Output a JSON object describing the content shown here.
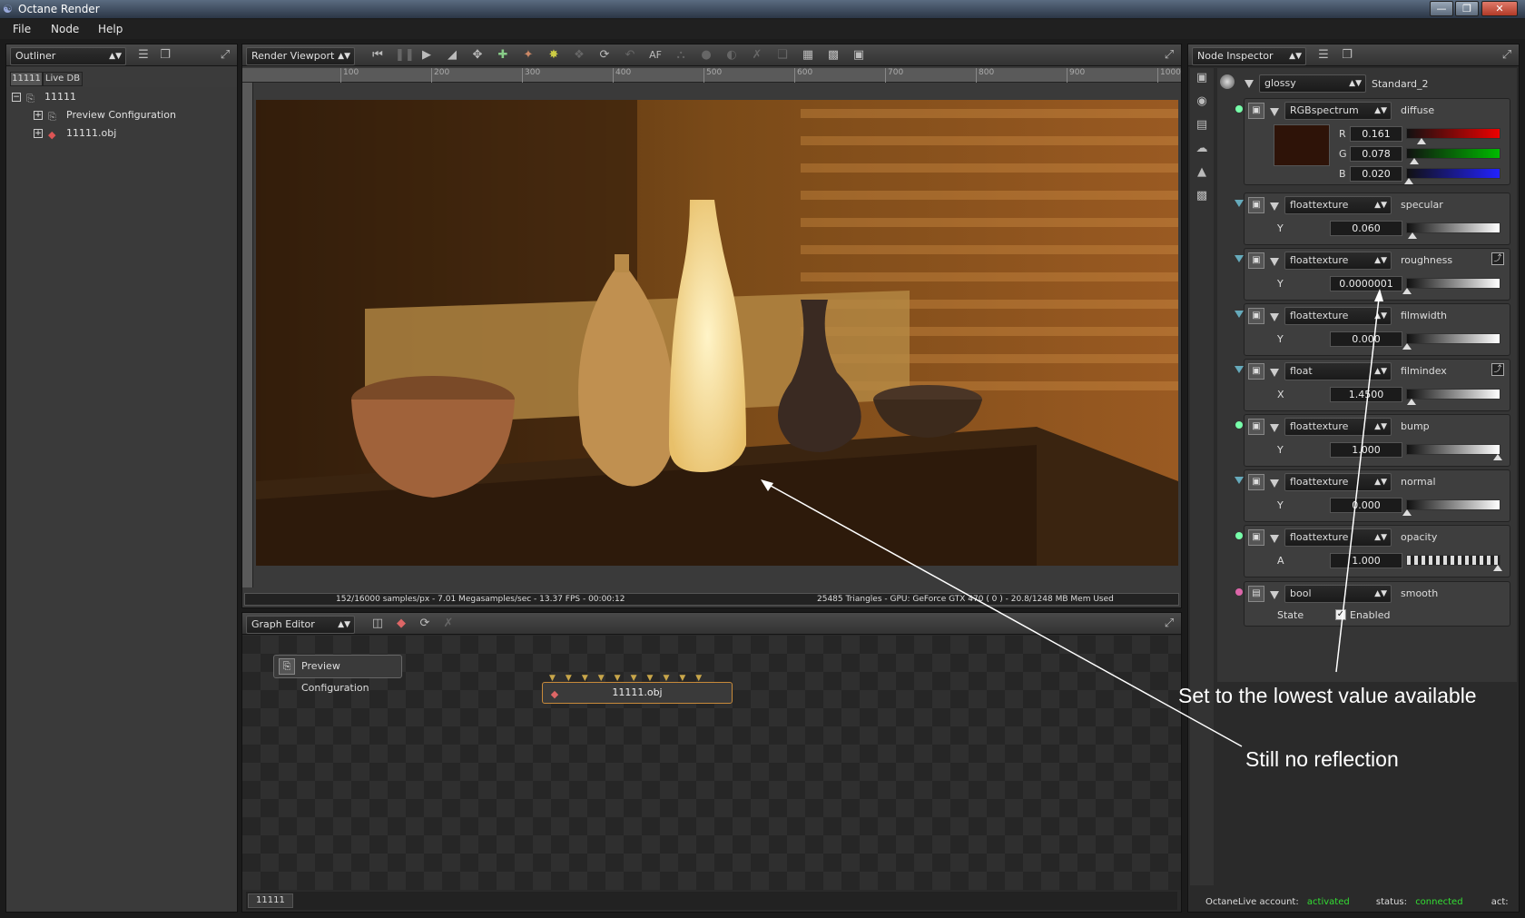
{
  "window": {
    "title": "Octane Render"
  },
  "menu": [
    "File",
    "Node",
    "Help"
  ],
  "outliner": {
    "dropdown": "Outliner",
    "tabs": [
      "11111",
      "Live DB"
    ],
    "tree": [
      {
        "label": "11111",
        "level": 0
      },
      {
        "label": "Preview Configuration",
        "level": 1
      },
      {
        "label": "11111.obj",
        "level": 1
      }
    ]
  },
  "viewport": {
    "dropdown": "Render Viewport",
    "af_label": "AF",
    "ruler_labels": [
      "100",
      "200",
      "300",
      "400",
      "500",
      "600",
      "700",
      "800",
      "900",
      "1000"
    ],
    "status_left": "152/16000 samples/px - 7.01 Megasamples/sec - 13.37 FPS - 00:00:12",
    "status_right": "25485 Triangles - GPU: GeForce GTX 470 ( 0 ) - 20.8/1248 MB Mem Used"
  },
  "graph_editor": {
    "dropdown": "Graph Editor",
    "nodes": [
      "Preview Configuration",
      "11111.obj"
    ],
    "bottom_tab": "11111"
  },
  "inspector": {
    "dropdown": "Node Inspector",
    "material_type": "glossy",
    "material_name": "Standard_2",
    "diffuse": {
      "type": "RGBspectrum",
      "name": "diffuse",
      "r_label": "R",
      "g_label": "G",
      "b_label": "B",
      "r": "0.161",
      "g": "0.078",
      "b": "0.020",
      "swatch": "#2e1308"
    },
    "params": [
      {
        "type": "floattexture",
        "name": "specular",
        "axis": "Y",
        "value": "0.060",
        "fraction": 0.06
      },
      {
        "type": "floattexture",
        "name": "roughness",
        "axis": "Y",
        "value": "0.0000001",
        "fraction": 0.0
      },
      {
        "type": "floattexture",
        "name": "filmwidth",
        "axis": "Y",
        "value": "0.000",
        "fraction": 0.0
      },
      {
        "type": "float",
        "name": "filmindex",
        "axis": "X",
        "value": "1.4500",
        "fraction": 0.05
      },
      {
        "type": "floattexture",
        "name": "bump",
        "axis": "Y",
        "value": "1.000",
        "fraction": 1.0
      },
      {
        "type": "floattexture",
        "name": "normal",
        "axis": "Y",
        "value": "0.000",
        "fraction": 0.0
      },
      {
        "type": "floattexture",
        "name": "opacity",
        "axis": "A",
        "value": "1.000",
        "fraction": 1.0
      }
    ],
    "smooth": {
      "type": "bool",
      "name": "smooth",
      "label": "State",
      "value_label": "Enabled",
      "checked": true
    },
    "footer": {
      "account_label": "OctaneLive account:",
      "account_value": "activated",
      "status_label": "status:",
      "status_value": "connected",
      "act_label": "act:"
    }
  },
  "annotations": {
    "lowest": "Set to  the lowest value available",
    "noreflection": "Still  no  reflection"
  },
  "colors": {
    "status_ok": "#33dd33",
    "accent_orange": "#c88a3a"
  }
}
